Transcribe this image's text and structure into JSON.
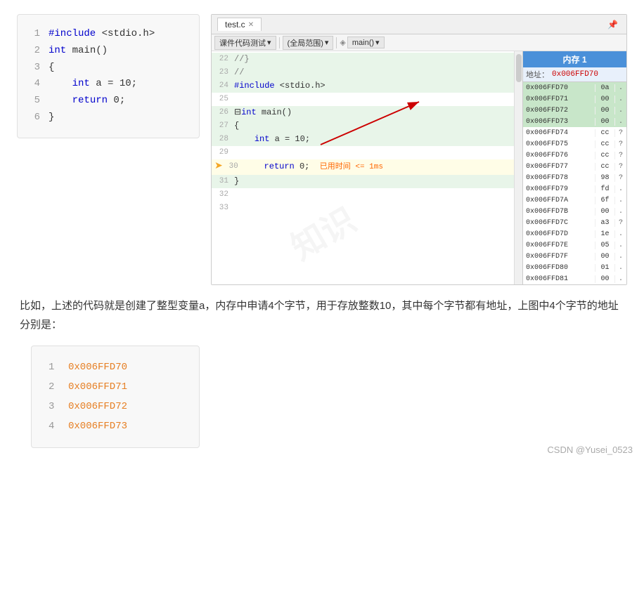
{
  "watermark": "知识",
  "left_code": {
    "lines": [
      {
        "ln": "1",
        "content": "#include <stdio.h>",
        "type": "include"
      },
      {
        "ln": "2",
        "content": "int main()",
        "type": "normal"
      },
      {
        "ln": "3",
        "content": "{",
        "type": "normal"
      },
      {
        "ln": "4",
        "content": "    int a = 10;",
        "type": "normal"
      },
      {
        "ln": "5",
        "content": "    return 0;",
        "type": "normal"
      },
      {
        "ln": "6",
        "content": "}",
        "type": "normal"
      }
    ]
  },
  "ide": {
    "tab_label": "test.c",
    "toolbar": {
      "btn1": "课件代码测试",
      "btn2": "(全局范围)",
      "btn3": "main()"
    },
    "editor_lines": [
      {
        "ln": "22",
        "content": "//}",
        "highlighted": true
      },
      {
        "ln": "23",
        "content": "//",
        "highlighted": true
      },
      {
        "ln": "24",
        "content": "#include <stdio.h>",
        "highlighted": true
      },
      {
        "ln": "25",
        "content": "",
        "highlighted": false
      },
      {
        "ln": "26",
        "content": "int main()",
        "highlighted": true,
        "has_expand": true
      },
      {
        "ln": "27",
        "content": "{",
        "highlighted": true
      },
      {
        "ln": "28",
        "content": "    int a = 10;",
        "highlighted": true
      },
      {
        "ln": "29",
        "content": "",
        "highlighted": false
      },
      {
        "ln": "30",
        "content": "    return 0;  已用时间 <= 1ms",
        "highlighted": false,
        "is_current": true,
        "has_arrow": true
      },
      {
        "ln": "31",
        "content": "}",
        "highlighted": true
      },
      {
        "ln": "32",
        "content": "",
        "highlighted": false
      },
      {
        "ln": "33",
        "content": "",
        "highlighted": false
      }
    ]
  },
  "memory": {
    "title": "内存 1",
    "address_label": "地址：",
    "address_value": "0x006FFD70",
    "rows": [
      {
        "addr": "0x006FFD70",
        "val": "0a",
        "char": ".",
        "highlighted": true
      },
      {
        "addr": "0x006FFD71",
        "val": "00",
        "char": ".",
        "highlighted": true
      },
      {
        "addr": "0x006FFD72",
        "val": "00",
        "char": ".",
        "highlighted": true
      },
      {
        "addr": "0x006FFD73",
        "val": "00",
        "char": ".",
        "highlighted": true
      },
      {
        "addr": "0x006FFD74",
        "val": "cc",
        "char": "?",
        "highlighted": false
      },
      {
        "addr": "0x006FFD75",
        "val": "cc",
        "char": "?",
        "highlighted": false
      },
      {
        "addr": "0x006FFD76",
        "val": "cc",
        "char": "?",
        "highlighted": false
      },
      {
        "addr": "0x006FFD77",
        "val": "cc",
        "char": "?",
        "highlighted": false
      },
      {
        "addr": "0x006FFD78",
        "val": "98",
        "char": "?",
        "highlighted": false
      },
      {
        "addr": "0x006FFD79",
        "val": "fd",
        "char": ".",
        "highlighted": false
      },
      {
        "addr": "0x006FFD7A",
        "val": "6f",
        "char": ".",
        "highlighted": false
      },
      {
        "addr": "0x006FFD7B",
        "val": "00",
        "char": ".",
        "highlighted": false
      },
      {
        "addr": "0x006FFD7C",
        "val": "a3",
        "char": "?",
        "highlighted": false
      },
      {
        "addr": "0x006FFD7D",
        "val": "1e",
        "char": ".",
        "highlighted": false
      },
      {
        "addr": "0x006FFD7E",
        "val": "05",
        "char": ".",
        "highlighted": false
      },
      {
        "addr": "0x006FFD7F",
        "val": "00",
        "char": ".",
        "highlighted": false
      },
      {
        "addr": "0x006FFD80",
        "val": "01",
        "char": ".",
        "highlighted": false
      },
      {
        "addr": "0x006FFD81",
        "val": "00",
        "char": ".",
        "highlighted": false
      }
    ]
  },
  "description": "比如，上述的代码就是创建了整型变量a，内存中申请4个字节，用于存放整数10，其中每个字节都有地址，上图中4个字节的地址分别是：",
  "addresses": [
    {
      "ln": "1",
      "val": "0x006FFD70"
    },
    {
      "ln": "2",
      "val": "0x006FFD71"
    },
    {
      "ln": "3",
      "val": "0x006FFD72"
    },
    {
      "ln": "4",
      "val": "0x006FFD73"
    }
  ],
  "footer": "CSDN  @Yusei_0523"
}
